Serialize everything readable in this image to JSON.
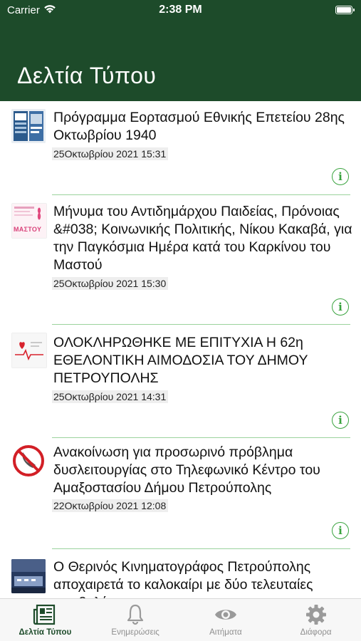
{
  "status_bar": {
    "carrier": "Carrier",
    "time": "2:38 PM"
  },
  "header": {
    "title": "Δελτία Τύπου",
    "background": "#1d4b2a"
  },
  "accent_color": "#3aa33f",
  "news": [
    {
      "title": "Πρόγραμμα Εορτασμού Εθνικής Επετείου 28ης Οκτωβρίου 1940",
      "date": "25Οκτωβρίου 2021 15:31",
      "thumb": "poster-thumbnail",
      "action_icon": "info-icon"
    },
    {
      "title": "Μήνυμα του Αντιδημάρχου Παιδείας, Πρόνοιας &#038; Κοινωνικής Πολιτικής, Νίκου Κακαβά, για την Παγκόσμια Ημέρα κατά του Καρκίνου του Μαστού",
      "date": "25Οκτωβρίου 2021 15:30",
      "thumb": "pink-ribbon-thumbnail",
      "thumb_text": "ΜΑΣΤΟΥ",
      "action_icon": "info-icon"
    },
    {
      "title": "ΟΛΟΚΛΗΡΩΘΗΚΕ ΜΕ ΕΠΙΤΥΧΙΑ Η 62η ΕΘΕΛΟΝΤΙΚΗ ΑΙΜΟΔΟΣΙΑ ΤΟΥ ΔΗΜΟΥ ΠΕΤΡΟΥΠΟΛΗΣ",
      "date": "25Οκτωβρίου 2021 14:31",
      "thumb": "blood-donation-thumbnail",
      "action_icon": "info-icon"
    },
    {
      "title": "Ανακοίνωση για προσωρινό πρόβλημα δυσλειτουργίας στο Τηλεφωνικό Κέντρο του Αμαξοστασίου Δήμου Πετρούπολης",
      "date": "22Οκτωβρίου 2021 12:08",
      "thumb": "no-phone-thumbnail",
      "action_icon": "info-icon"
    },
    {
      "title": "Ο Θερινός Κινηματογράφος Πετρούπολης αποχαιρετά το καλοκαίρι με δύο τελευταίες προβολές",
      "date": "",
      "thumb": "cinema-thumbnail",
      "action_icon": "info-icon"
    }
  ],
  "tabs": [
    {
      "label": "Δελτία Τύπου",
      "icon": "newspaper-icon",
      "active": true
    },
    {
      "label": "Ενημερώσεις",
      "icon": "bell-icon",
      "active": false
    },
    {
      "label": "Αιτήματα",
      "icon": "eye-icon",
      "active": false
    },
    {
      "label": "Διάφορα",
      "icon": "gear-icon",
      "active": false
    }
  ]
}
